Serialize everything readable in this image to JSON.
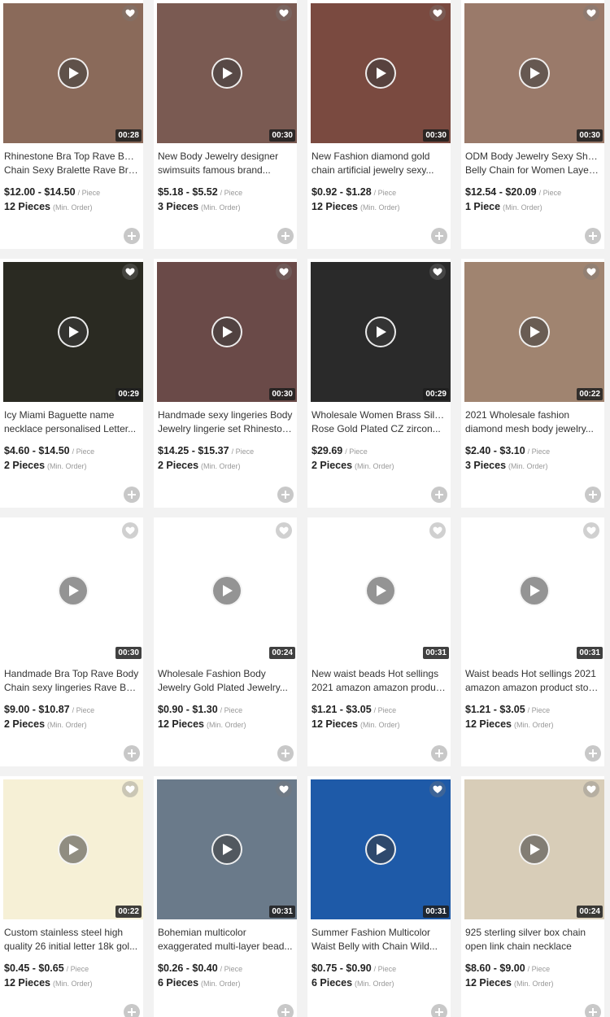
{
  "products": [
    {
      "title_line1": "Rhinestone Bra Top Rave Body",
      "title_line2": "Chain Sexy Bralette Rave Bra...",
      "price": "$12.00 - $14.50",
      "unit": "/ Piece",
      "moq": "12 Pieces",
      "moq_label": "(Min. Order)",
      "duration": "00:28",
      "image_color": "#8a6a5a"
    },
    {
      "title_line1": "New Body Jewelry designer",
      "title_line2": "swimsuits famous brand...",
      "price": "$5.18 - $5.52",
      "unit": "/ Piece",
      "moq": "3 Pieces",
      "moq_label": "(Min. Order)",
      "duration": "00:30",
      "image_color": "#7a5a52"
    },
    {
      "title_line1": "New Fashion diamond gold",
      "title_line2": "chain artificial jewelry sexy...",
      "price": "$0.92 - $1.28",
      "unit": "/ Piece",
      "moq": "12 Pieces",
      "moq_label": "(Min. Order)",
      "duration": "00:30",
      "image_color": "#7a4a40"
    },
    {
      "title_line1": "ODM Body Jewelry Sexy Shorts",
      "title_line2": "Belly Chain for Women Layere...",
      "price": "$12.54 - $20.09",
      "unit": "/ Piece",
      "moq": "1 Piece",
      "moq_label": "(Min. Order)",
      "duration": "00:30",
      "image_color": "#9a7a6a"
    },
    {
      "title_line1": "Icy Miami Baguette name",
      "title_line2": "necklace personalised Letter...",
      "price": "$4.60 - $14.50",
      "unit": "/ Piece",
      "moq": "2 Pieces",
      "moq_label": "(Min. Order)",
      "duration": "00:29",
      "image_color": "#2a2a22"
    },
    {
      "title_line1": "Handmade sexy lingeries Body",
      "title_line2": "Jewelry lingerie set Rhineston...",
      "price": "$14.25 - $15.37",
      "unit": "/ Piece",
      "moq": "2 Pieces",
      "moq_label": "(Min. Order)",
      "duration": "00:30",
      "image_color": "#6a4a48"
    },
    {
      "title_line1": "Wholesale Women Brass Silver",
      "title_line2": "Rose Gold Plated CZ zircon...",
      "price": "$29.69",
      "unit": "/ Piece",
      "moq": "2 Pieces",
      "moq_label": "(Min. Order)",
      "duration": "00:29",
      "image_color": "#2a2a2a"
    },
    {
      "title_line1": "2021 Wholesale fashion",
      "title_line2": "diamond mesh body jewelry...",
      "price": "$2.40 - $3.10",
      "unit": "/ Piece",
      "moq": "3 Pieces",
      "moq_label": "(Min. Order)",
      "duration": "00:22",
      "image_color": "#a08470"
    },
    {
      "title_line1": "Handmade Bra Top Rave Body",
      "title_line2": "Chain sexy lingeries Rave Bra...",
      "price": "$9.00 - $10.87",
      "unit": "/ Piece",
      "moq": "2 Pieces",
      "moq_label": "(Min. Order)",
      "duration": "00:30",
      "image_color": "#ffffff"
    },
    {
      "title_line1": "Wholesale Fashion Body",
      "title_line2": "Jewelry Gold Plated Jewelry...",
      "price": "$0.90 - $1.30",
      "unit": "/ Piece",
      "moq": "12 Pieces",
      "moq_label": "(Min. Order)",
      "duration": "00:24",
      "image_color": "#ffffff"
    },
    {
      "title_line1": "New waist beads Hot sellings",
      "title_line2": "2021 amazon amazon produc...",
      "price": "$1.21 - $3.05",
      "unit": "/ Piece",
      "moq": "12 Pieces",
      "moq_label": "(Min. Order)",
      "duration": "00:31",
      "image_color": "#ffffff"
    },
    {
      "title_line1": "Waist beads Hot sellings 2021",
      "title_line2": "amazon amazon product ston...",
      "price": "$1.21 - $3.05",
      "unit": "/ Piece",
      "moq": "12 Pieces",
      "moq_label": "(Min. Order)",
      "duration": "00:31",
      "image_color": "#ffffff"
    },
    {
      "title_line1": "Custom stainless steel high",
      "title_line2": "quality 26 initial letter 18k gol...",
      "price": "$0.45 - $0.65",
      "unit": "/ Piece",
      "moq": "12 Pieces",
      "moq_label": "(Min. Order)",
      "duration": "00:22",
      "image_color": "#f6f0d6"
    },
    {
      "title_line1": "Bohemian multicolor",
      "title_line2": "exaggerated multi-layer bead...",
      "price": "$0.26 - $0.40",
      "unit": "/ Piece",
      "moq": "6 Pieces",
      "moq_label": "(Min. Order)",
      "duration": "00:31",
      "image_color": "#6a7a8a"
    },
    {
      "title_line1": "Summer Fashion Multicolor",
      "title_line2": "Waist Belly with Chain Wild...",
      "price": "$0.75 - $0.90",
      "unit": "/ Piece",
      "moq": "6 Pieces",
      "moq_label": "(Min. Order)",
      "duration": "00:31",
      "image_color": "#1e5aa8"
    },
    {
      "title_line1": "925 sterling silver box chain",
      "title_line2": "open link chain necklace",
      "price": "$8.60 - $9.00",
      "unit": "/ Piece",
      "moq": "12 Pieces",
      "moq_label": "(Min. Order)",
      "duration": "00:24",
      "image_color": "#d8cdb8"
    }
  ]
}
